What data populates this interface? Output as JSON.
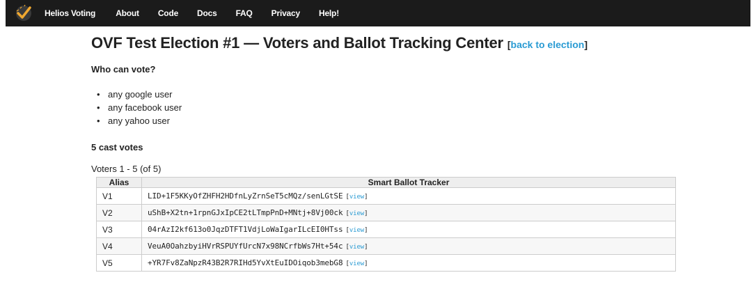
{
  "nav": {
    "brand": "Helios Voting",
    "items": [
      "About",
      "Code",
      "Docs",
      "FAQ",
      "Privacy",
      "Help!"
    ]
  },
  "page": {
    "title": "OVF Test Election #1 — Voters and Ballot Tracking Center",
    "back_open": "[",
    "back_link": "back to election",
    "back_close": "]"
  },
  "eligibility": {
    "heading": "Who can vote?",
    "items": [
      "any google user",
      "any facebook user",
      "any yahoo user"
    ]
  },
  "votes": {
    "count_label": "5 cast votes",
    "range_label": "Voters 1 - 5 (of 5)"
  },
  "table": {
    "headers": [
      "Alias",
      "Smart Ballot Tracker"
    ],
    "view_open": "[",
    "view_label": "view",
    "view_close": "]",
    "rows": [
      {
        "alias": "V1",
        "tracker": "LID+1F5KKyOfZHFH2HDfnLyZrnSeT5cMQz/senLGtSE"
      },
      {
        "alias": "V2",
        "tracker": "uShB+X2tn+1rpnGJxIpCE2tLTmpPnD+MNtj+8Vj00ck"
      },
      {
        "alias": "V3",
        "tracker": "04rAzI2kf613o0JqzDTFT1VdjLoWaIgarILcEI0HTss"
      },
      {
        "alias": "V4",
        "tracker": "VeuA0OahzbyiHVrRSPUYfUrcN7x98NCrfbWs7Ht+54c"
      },
      {
        "alias": "V5",
        "tracker": "+YR7Fv8ZaNpzR43B2R7RIHd5YvXtEuIDOiqob3mebG8"
      }
    ]
  },
  "colors": {
    "topbar": "#1b1b1b",
    "link": "#2a9bd3",
    "logo_check": "#f0a830"
  }
}
